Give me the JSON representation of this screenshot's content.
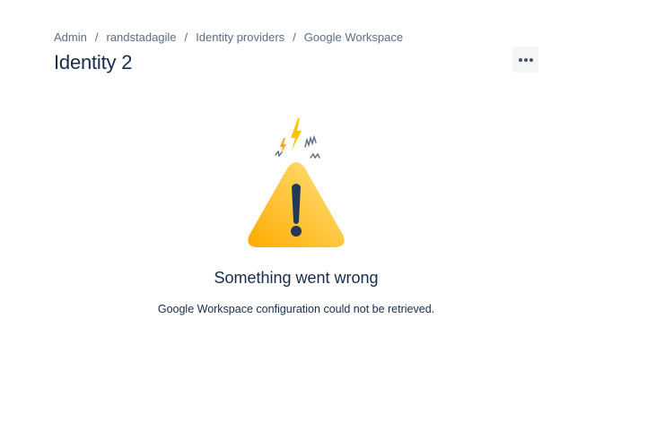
{
  "breadcrumb": {
    "items": [
      "Admin",
      "randstadagile",
      "Identity providers",
      "Google Workspace"
    ],
    "separator": "/"
  },
  "header": {
    "title": "Identity 2",
    "more_icon": "more-horizontal-icon"
  },
  "error": {
    "icon": "warning-triangle-icon",
    "title": "Something went wrong",
    "message": "Google Workspace configuration could not be retrieved."
  },
  "colors": {
    "warning_yellow": "#FFC400",
    "warning_orange": "#FFAB00",
    "text_primary": "#172B4D",
    "text_subtle": "#5E6C84",
    "button_bg": "#F4F5F7"
  }
}
